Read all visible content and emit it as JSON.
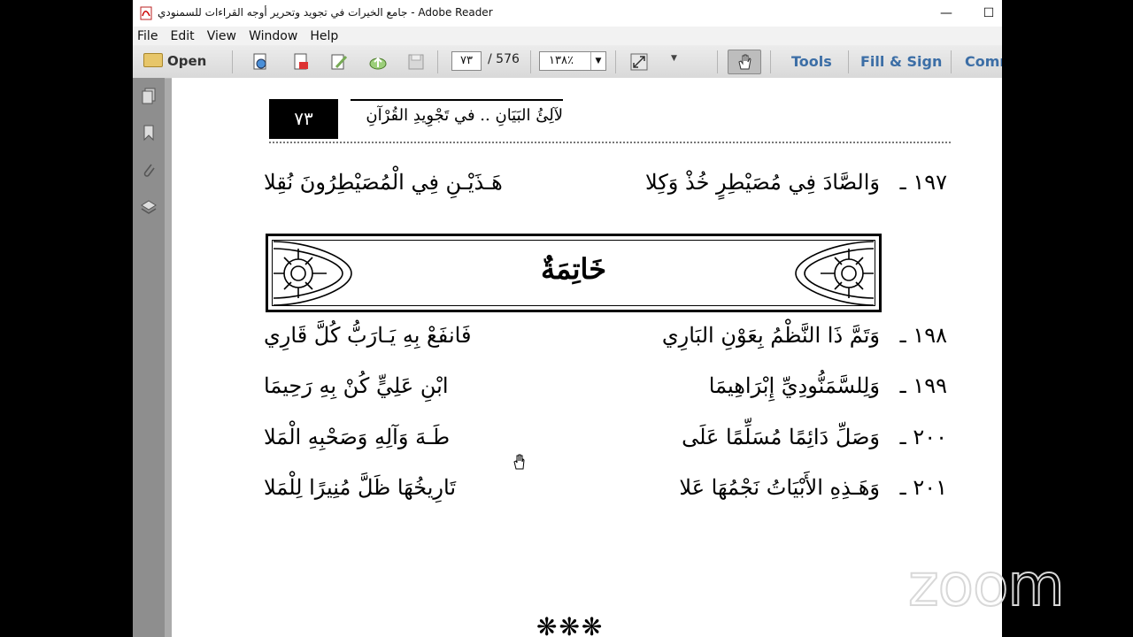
{
  "window": {
    "title": "جامع الخيرات في تجويد وتحرير أوجه القراءات للسمنودي - Adobe Reader",
    "minimize_glyph": "—",
    "maximize_glyph": "☐"
  },
  "menu": [
    "File",
    "Edit",
    "View",
    "Window",
    "Help"
  ],
  "toolbar": {
    "open_label": "Open",
    "current_page": "٧٣",
    "page_total": "/ 576",
    "zoom_level": "١٣٨٪",
    "tools_label": "Tools",
    "fill_sign_label": "Fill & Sign",
    "comment_label": "Comm"
  },
  "document": {
    "page_number": "٧٣",
    "header_title": "لآلِئُ البَيَانِ .. في تَجْوِيدِ القُرْآنِ",
    "verses": [
      {
        "num": "١٩٧ ـ",
        "h1": "وَالصَّادَ فِي مُصَيْطِرٍ خُذْ وَكِلا",
        "h2": "هَـذَيْـنِ فِي الْمُصَيْطِرُونَ نُقِلا"
      },
      {
        "num": "١٩٨ ـ",
        "h1": "وَتَمَّ ذَا النَّظْمُ بِعَوْنِ البَارِي",
        "h2": "فَانفَعْ بِهِ يَـارَبُّ كُلَّ قَارِي"
      },
      {
        "num": "١٩٩ ـ",
        "h1": "وَلِلسَّمَنُّودِيِّ إِبْرَاهِيمَا",
        "h2": "ابْنِ عَلِيٍّ كُنْ بِهِ رَحِيمَا"
      },
      {
        "num": "٢٠٠ ـ",
        "h1": "وَصَلِّ دَائِمًا مُسَلِّمًا عَلَى",
        "h2": "طَـهَ وَآلِهِ وَصَحْبِهِ الْمَلا"
      },
      {
        "num": "٢٠١ ـ",
        "h1": "وَهَـذِهِ الأَبْيَاتُ نَجْمُهَا عَلا",
        "h2": "تَارِيخُهَا ظَلَّ مُنِيرًا لِلْمَلا"
      }
    ],
    "section_title": "خَاتِمَةٌ",
    "end_mark": "❋❋❋"
  },
  "overlay": {
    "zoom_logo": "zoom"
  }
}
